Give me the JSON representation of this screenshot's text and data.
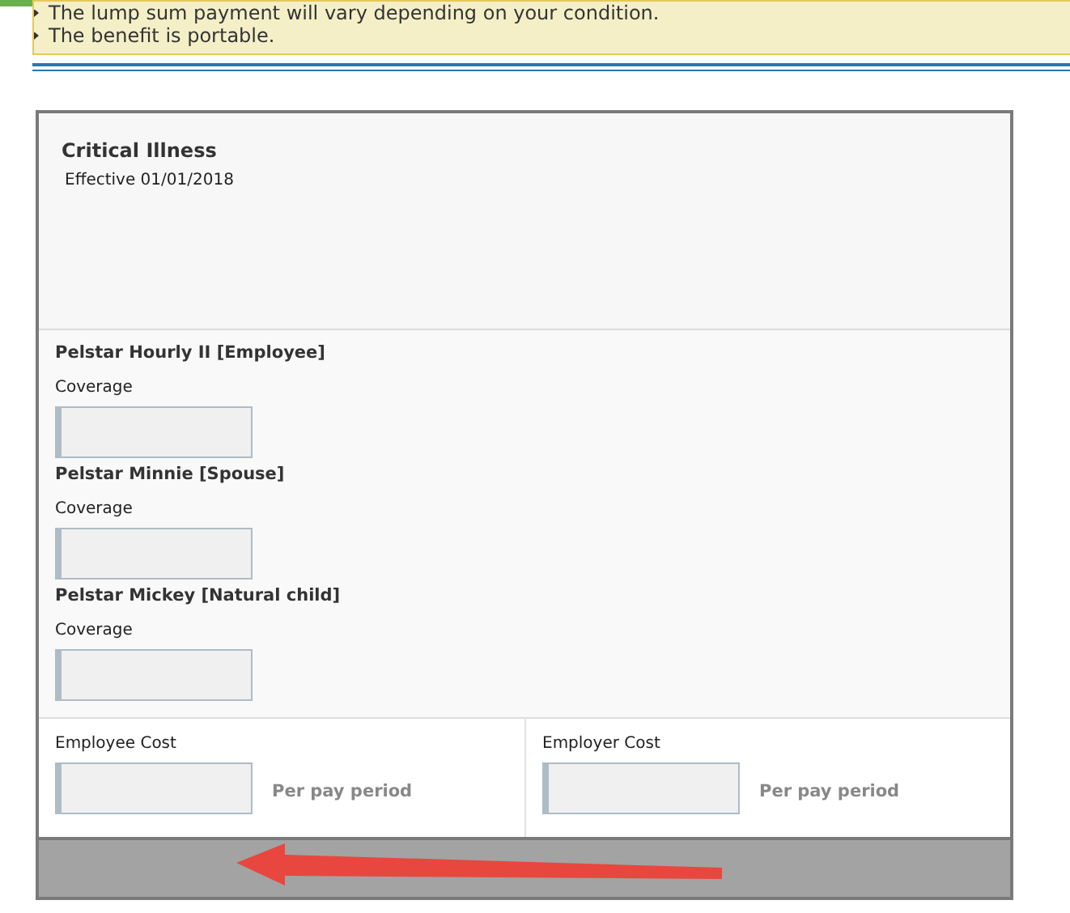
{
  "notice": {
    "items": [
      "The lump sum payment will vary depending on your condition.",
      "The benefit is portable."
    ]
  },
  "plan": {
    "title": "Critical Illness",
    "effective": "Effective 01/01/2018"
  },
  "members": [
    {
      "name": "Pelstar Hourly II [Employee]",
      "field_label": "Coverage"
    },
    {
      "name": "Pelstar Minnie [Spouse]",
      "field_label": "Coverage"
    },
    {
      "name": "Pelstar Mickey [Natural child]",
      "field_label": "Coverage"
    }
  ],
  "costs": [
    {
      "label": "Employee Cost",
      "unit": "Per pay period"
    },
    {
      "label": "Employer Cost",
      "unit": "Per pay period"
    }
  ]
}
